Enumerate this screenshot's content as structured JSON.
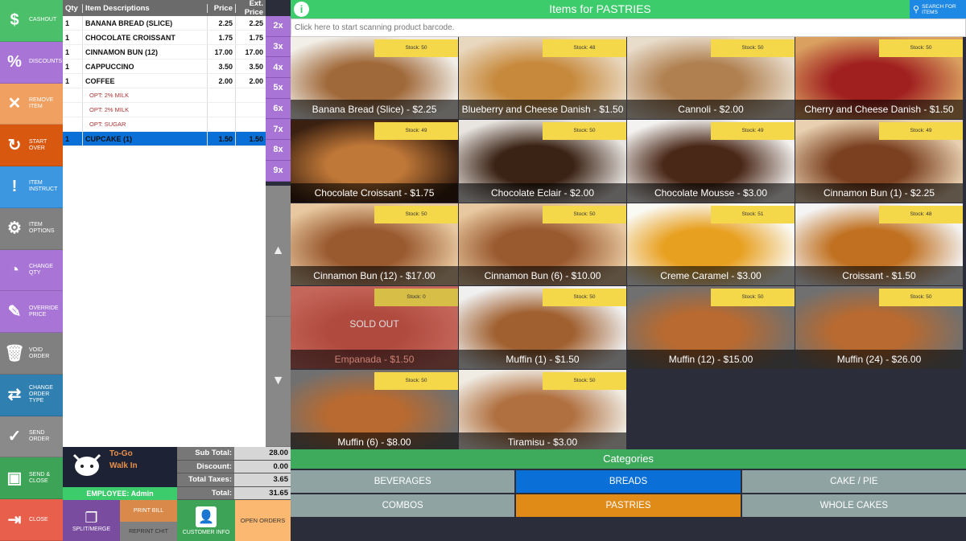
{
  "sidebar": [
    {
      "label": "CASHOUT",
      "icon": "dollar-icon",
      "glyph": "$",
      "color": "#4cbf6b"
    },
    {
      "label": "DISCOUNTS",
      "icon": "percent-icon",
      "glyph": "%",
      "color": "#a874d6"
    },
    {
      "label": "REMOVE ITEM",
      "icon": "remove-icon",
      "glyph": "✕",
      "color": "#f0a060"
    },
    {
      "label": "START OVER",
      "icon": "refresh-icon",
      "glyph": "↻",
      "color": "#d9580f"
    },
    {
      "label": "ITEM INSTRUCT",
      "icon": "comment-icon",
      "glyph": "!",
      "color": "#3d97e0"
    },
    {
      "label": "ITEM OPTIONS",
      "icon": "gear-icon",
      "glyph": "⚙",
      "color": "#808080"
    },
    {
      "label": "CHANGE QTY",
      "icon": "qty-icon",
      "glyph": "◔",
      "color": "#a874d6"
    },
    {
      "label": "OVERRIDE PRICE",
      "icon": "pencil-icon",
      "glyph": "✎",
      "color": "#a874d6"
    },
    {
      "label": "VOID ORDER",
      "icon": "trash-icon",
      "glyph": "🗑",
      "color": "#808080"
    },
    {
      "label": "CHANGE ORDER TYPE",
      "icon": "swap-icon",
      "glyph": "⇄",
      "color": "#2f7fb0"
    },
    {
      "label": "SEND ORDER",
      "icon": "check-icon",
      "glyph": "✓",
      "color": "#8a8a8a"
    },
    {
      "label": "SEND & CLOSE",
      "icon": "save-icon",
      "glyph": "▣",
      "color": "#3da356"
    },
    {
      "label": "CLOSE",
      "icon": "exit-icon",
      "glyph": "⇥",
      "color": "#e8604c"
    }
  ],
  "order": {
    "headers": {
      "qty": "Qty",
      "desc": "Item Descriptions",
      "price": "Price",
      "ext": "Ext. Price"
    },
    "rows": [
      {
        "qty": "1",
        "desc": "BANANA BREAD (SLICE)",
        "price": "2.25",
        "ext": "2.25",
        "type": "item"
      },
      {
        "qty": "1",
        "desc": "CHOCOLATE CROISSANT",
        "price": "1.75",
        "ext": "1.75",
        "type": "item"
      },
      {
        "qty": "1",
        "desc": "CINNAMON BUN (12)",
        "price": "17.00",
        "ext": "17.00",
        "type": "item"
      },
      {
        "qty": "1",
        "desc": "CAPPUCCINO",
        "price": "3.50",
        "ext": "3.50",
        "type": "item"
      },
      {
        "qty": "1",
        "desc": "COFFEE",
        "price": "2.00",
        "ext": "2.00",
        "type": "item"
      },
      {
        "qty": "",
        "desc": "OPT: 2% MILK",
        "price": "",
        "ext": "",
        "type": "opt"
      },
      {
        "qty": "",
        "desc": "OPT: 2% MILK",
        "price": "",
        "ext": "",
        "type": "opt"
      },
      {
        "qty": "",
        "desc": "OPT: SUGAR",
        "price": "",
        "ext": "",
        "type": "opt"
      },
      {
        "qty": "1",
        "desc": "CUPCAKE (1)",
        "price": "1.50",
        "ext": "1.50",
        "type": "sel"
      }
    ]
  },
  "multipliers": [
    "2x",
    "3x",
    "4x",
    "5x",
    "6x",
    "7x",
    "8x",
    "9x"
  ],
  "customer": {
    "type": "To-Go",
    "name": "Walk In",
    "employee": "EMPLOYEE: Admin"
  },
  "totals": [
    {
      "label": "Sub Total:",
      "value": "28.00"
    },
    {
      "label": "Discount:",
      "value": "0.00"
    },
    {
      "label": "Total Taxes:",
      "value": "3.65"
    },
    {
      "label": "Total:",
      "value": "31.65"
    }
  ],
  "bottom": {
    "split": "SPLIT/MERGE",
    "print": "PRINT BILL",
    "reprint": "REPRINT CHIT",
    "customer": "CUSTOMER INFO",
    "open": "OPEN ORDERS"
  },
  "header": {
    "title": "Items for PASTRIES",
    "search": "SEARCH FOR ITEMS",
    "scan_placeholder": "Click here to start scanning product barcode."
  },
  "products": [
    {
      "name": "Banana Bread (Slice) - $2.25",
      "stock": "Stock: 50",
      "colors": [
        "#f2efe8",
        "#a0693a"
      ]
    },
    {
      "name": "Blueberry and Cheese Danish - $1.50",
      "stock": "Stock: 48",
      "colors": [
        "#e9d8c0",
        "#c78a3d"
      ]
    },
    {
      "name": "Cannoli - $2.00",
      "stock": "Stock: 50",
      "colors": [
        "#e8dccb",
        "#b08050"
      ]
    },
    {
      "name": "Cherry and Cheese Danish - $1.50",
      "stock": "Stock: 50",
      "colors": [
        "#d9a060",
        "#a02020"
      ]
    },
    {
      "name": "Chocolate Croissant - $1.75",
      "stock": "Stock: 49",
      "colors": [
        "#3a2010",
        "#c07838"
      ]
    },
    {
      "name": "Chocolate Eclair - $2.00",
      "stock": "Stock: 50",
      "colors": [
        "#e8e4e0",
        "#3a2214"
      ]
    },
    {
      "name": "Chocolate Mousse - $3.00",
      "stock": "Stock: 49",
      "colors": [
        "#f4f2f0",
        "#4a2818"
      ]
    },
    {
      "name": "Cinnamon Bun (1) - $2.25",
      "stock": "Stock: 49",
      "colors": [
        "#e8d0b0",
        "#7a4020"
      ]
    },
    {
      "name": "Cinnamon Bun (12) - $17.00",
      "stock": "Stock: 50",
      "colors": [
        "#e8c8a0",
        "#9a5a30"
      ]
    },
    {
      "name": "Cinnamon Bun (6) - $10.00",
      "stock": "Stock: 50",
      "colors": [
        "#e8c8a0",
        "#9a5a30"
      ]
    },
    {
      "name": "Creme Caramel - $3.00",
      "stock": "Stock: 51",
      "colors": [
        "#fafaf5",
        "#e8a020"
      ]
    },
    {
      "name": "Croissant - $1.50",
      "stock": "Stock: 48",
      "colors": [
        "#f4f4f4",
        "#c07020"
      ]
    },
    {
      "name": "Empanada - $1.50",
      "stock": "Stock: 0",
      "colors": [
        "#e07060",
        "#c85040"
      ],
      "sold_out": "SOLD OUT"
    },
    {
      "name": "Muffin (1) - $1.50",
      "stock": "Stock: 50",
      "colors": [
        "#f0f0f0",
        "#a06030"
      ]
    },
    {
      "name": "Muffin (12) - $15.00",
      "stock": "Stock: 50",
      "colors": [
        "#707070",
        "#b86a30"
      ]
    },
    {
      "name": "Muffin (24) - $26.00",
      "stock": "Stock: 50",
      "colors": [
        "#707070",
        "#b86a30"
      ]
    },
    {
      "name": "Muffin (6) - $8.00",
      "stock": "Stock: 50",
      "colors": [
        "#707070",
        "#b86a30"
      ]
    },
    {
      "name": "Tiramisu - $3.00",
      "stock": "Stock: 50",
      "colors": [
        "#f0ece4",
        "#b07040"
      ]
    }
  ],
  "categories": {
    "title": "Categories",
    "items": [
      {
        "label": "BEVERAGES",
        "color": "#8fa3a3"
      },
      {
        "label": "BREADS",
        "color": "#0a6fd6"
      },
      {
        "label": "CAKE / PIE",
        "color": "#8fa3a3"
      },
      {
        "label": "COMBOS",
        "color": "#8fa3a3"
      },
      {
        "label": "PASTRIES",
        "color": "#e08a18"
      },
      {
        "label": "WHOLE CAKES",
        "color": "#8fa3a3"
      }
    ]
  }
}
